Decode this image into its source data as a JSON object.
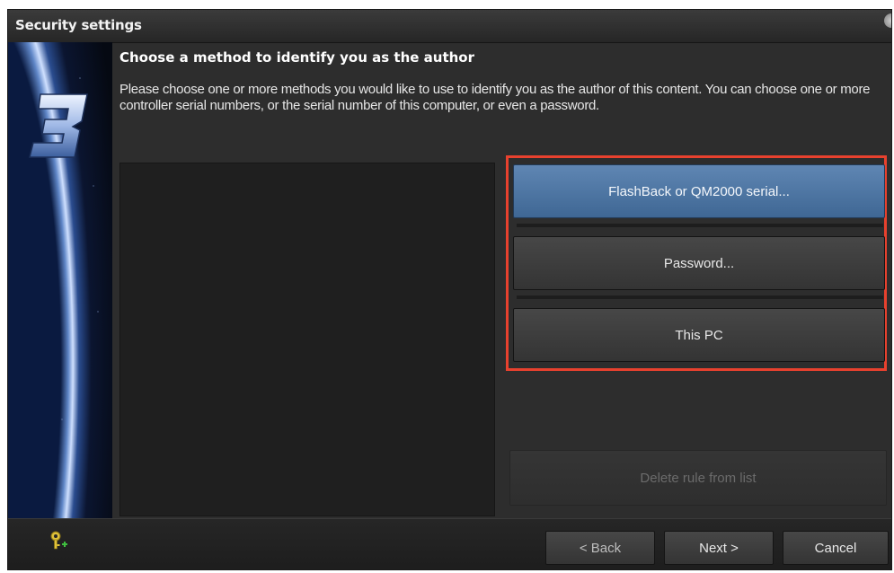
{
  "window": {
    "title": "Security settings"
  },
  "content": {
    "heading": "Choose a method to identify you as the author",
    "description": "Please  choose one or more methods you would like to use to identify you as the author of this content.  You can choose one or more controller serial numbers, or the serial number of this computer, or even a password."
  },
  "methods": {
    "flashback_label": "FlashBack or QM2000 serial...",
    "password_label": "Password...",
    "this_pc_label": "This PC"
  },
  "actions": {
    "delete_rule_label": "Delete rule from list"
  },
  "footer": {
    "back_label": "< Back",
    "next_label": "Next >",
    "cancel_label": "Cancel"
  },
  "icons": {
    "logo": "version-3-logo",
    "key": "key-add-icon"
  },
  "colors": {
    "highlight": "#e8412e",
    "primary_button": "#4f77a4",
    "key_icon": "#e0c23a",
    "key_plus": "#3fbf3f"
  }
}
